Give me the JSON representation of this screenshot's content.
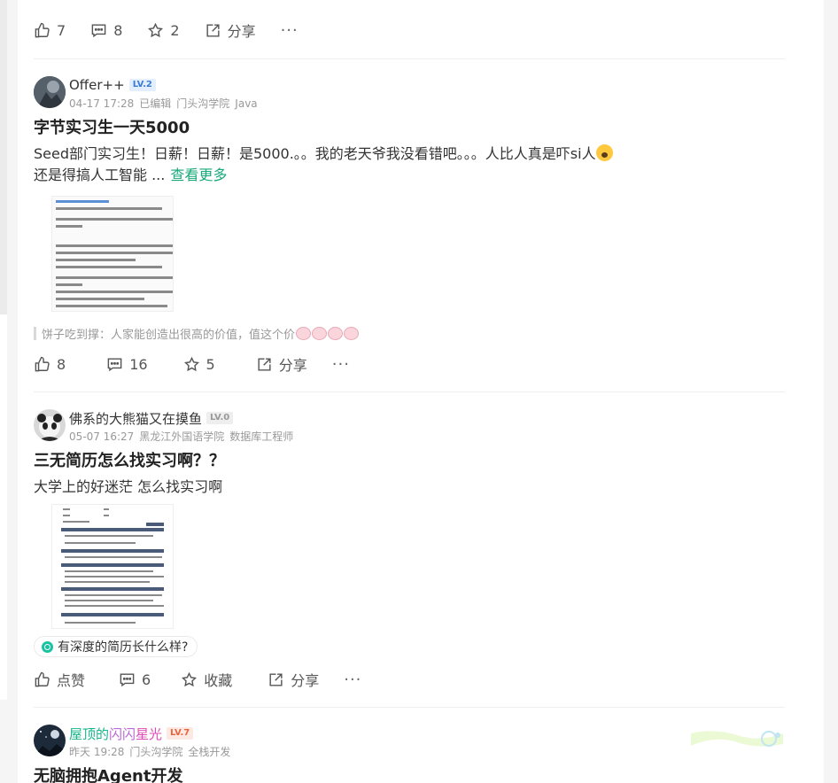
{
  "prev_post": {
    "actions": {
      "like": "7",
      "comment": "8",
      "star": "2",
      "share": "分享",
      "more": "···"
    }
  },
  "posts": [
    {
      "author": {
        "name": "Offer++",
        "level": "LV.2"
      },
      "meta": {
        "time": "04-17 17:28",
        "edited": "已编辑",
        "school": "门头沟学院",
        "role": "Java"
      },
      "title": "字节实习生一天5000",
      "body_line1": "Seed部门实习生！日薪！日薪！是5000.。。我的老天爷我没看错吧。。。人比人真是吓si人",
      "body_line2": "还是得搞人工智能 ...",
      "more_link": "查看更多",
      "hot_comment": "饼子吃到撑：人家能创造出很高的价值，值这个价",
      "actions": {
        "like": "8",
        "comment": "16",
        "star": "5",
        "share": "分享",
        "more": "···"
      },
      "colors": {
        "level_bg": "#e3efff",
        "level_fg": "#3a7bd5"
      }
    },
    {
      "author": {
        "name": "佛系的大熊猫又在摸鱼",
        "level": "LV.0"
      },
      "meta": {
        "time": "05-07 16:27",
        "school": "黑龙江外国语学院",
        "role": "数据库工程师"
      },
      "title": "三无简历怎么找实习啊？？",
      "body_line1": "大学上的好迷茫 怎么找实习啊",
      "tag": "有深度的简历长什么样?",
      "actions": {
        "like": "点赞",
        "comment": "6",
        "star": "收藏",
        "share": "分享",
        "more": "···"
      },
      "colors": {
        "level_bg": "#eeeeee",
        "level_fg": "#999999"
      }
    },
    {
      "author": {
        "name_part1": "屋顶的",
        "name_part2": "闪闪",
        "name_part3": "星光",
        "level": "LV.7"
      },
      "meta": {
        "time": "昨天 19:28",
        "school": "门头沟学院",
        "role": "全栈开发"
      },
      "title": "无脑拥抱Agent开发",
      "colors": {
        "level_bg": "#fde9e4",
        "level_fg": "#e8643c",
        "name_c1": "#19b58a",
        "name_c2": "#b86ad8",
        "name_c3": "#e04bb8"
      }
    }
  ]
}
